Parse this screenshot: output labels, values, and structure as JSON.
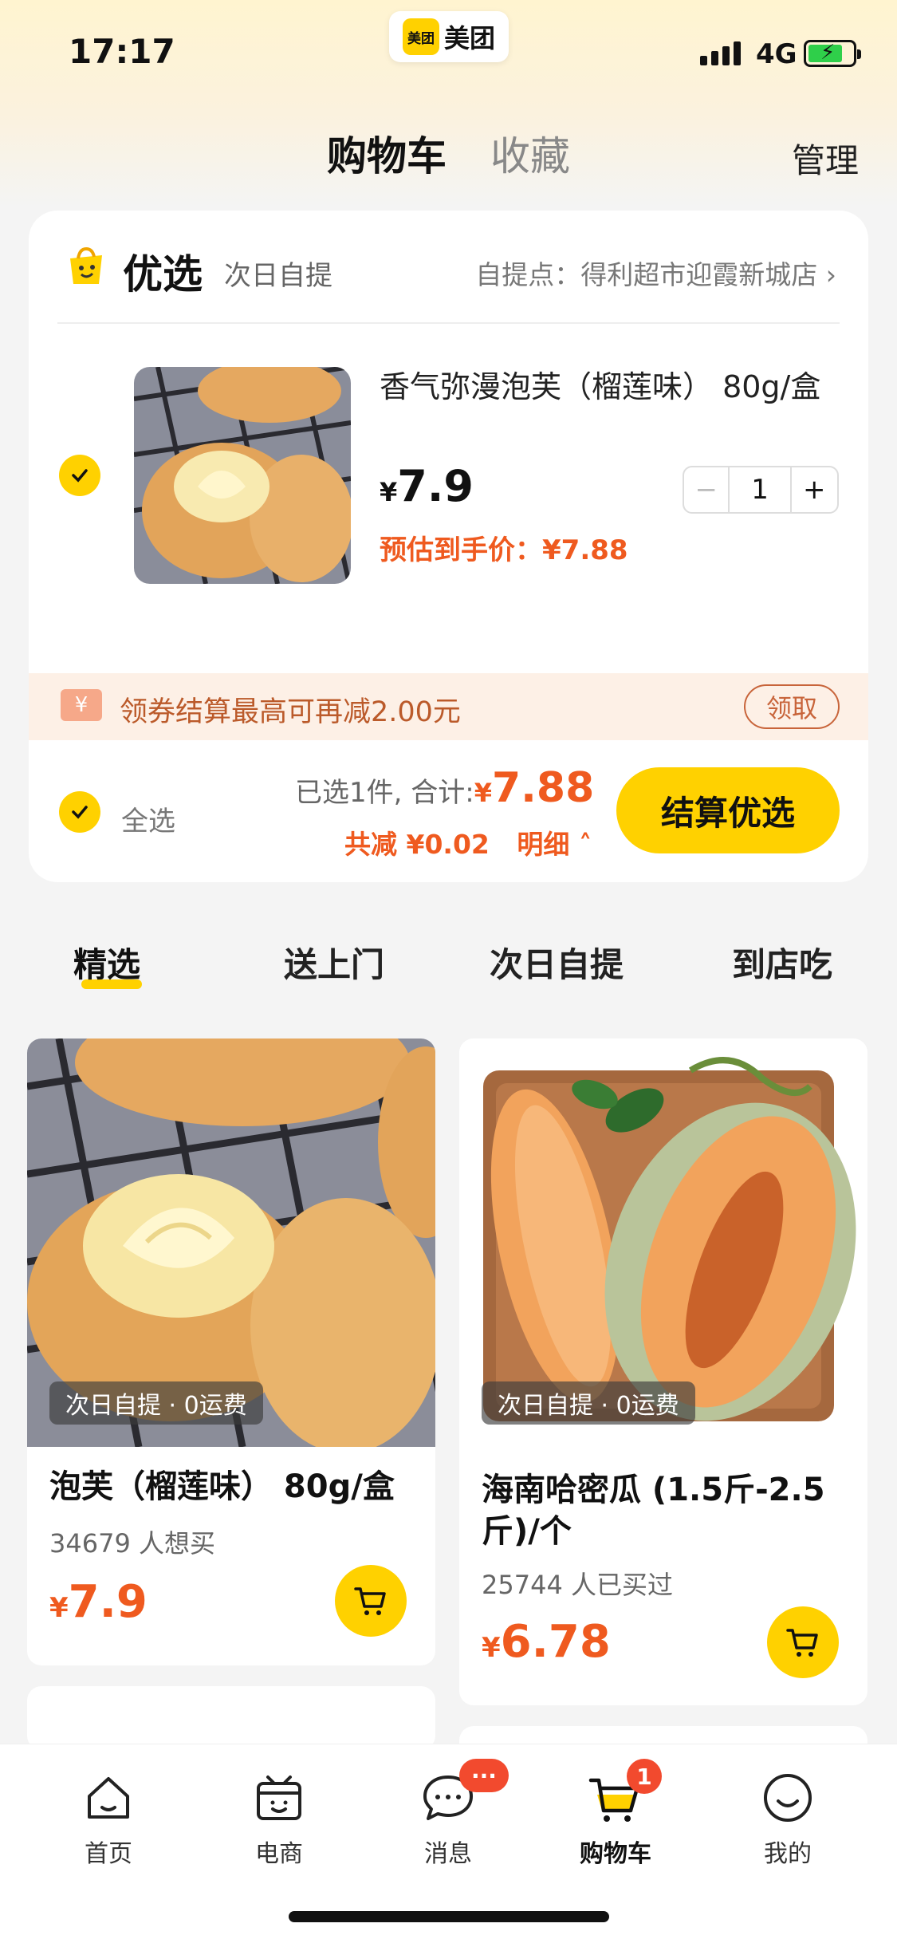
{
  "status_bar": {
    "time": "17:17",
    "network": "4G",
    "brand_logo": "美团",
    "brand_name": "美团"
  },
  "header": {
    "tab_cart": "购物车",
    "tab_favorites": "收藏",
    "manage": "管理"
  },
  "cart": {
    "store_name": "优选",
    "store_sub": "次日自提",
    "pickup_point": "自提点：得利超市迎霞新城店",
    "item": {
      "title": "香气弥漫泡芙（榴莲味） 80g/盒",
      "price_symbol": "¥",
      "price": "7.9",
      "estimate": "预估到手价：¥7.88",
      "quantity": "1",
      "minus": "−",
      "plus": "+",
      "selected": true
    },
    "coupon": {
      "icon_text": "¥",
      "text": "领券结算最高可再减2.00元",
      "button": "领取"
    },
    "footer": {
      "select_all": "全选",
      "summary_prefix": "已选1件, 合计:",
      "total_symbol": "¥",
      "total": "7.88",
      "discount": "共减 ¥0.02",
      "detail": "明细",
      "checkout": "结算优选"
    }
  },
  "categories": [
    "精选",
    "送上门",
    "次日自提",
    "到店吃"
  ],
  "products": [
    {
      "tag": "次日自提 · 0运费",
      "title": "泡芙（榴莲味） 80g/盒",
      "sold": "34679 人想买",
      "price_symbol": "¥",
      "price": "7.9"
    },
    {
      "tag": "次日自提 · 0运费",
      "title": "海南哈密瓜 (1.5斤-2.5斤)/个",
      "sold": "25744 人已买过",
      "price_symbol": "¥",
      "price": "6.78"
    }
  ],
  "bottom_nav": [
    {
      "label": "首页",
      "icon": "home-icon"
    },
    {
      "label": "电商",
      "icon": "shop-icon"
    },
    {
      "label": "消息",
      "icon": "message-icon",
      "badge": "···"
    },
    {
      "label": "购物车",
      "icon": "cart-icon",
      "badge": "1",
      "active": true
    },
    {
      "label": "我的",
      "icon": "profile-icon"
    }
  ],
  "colors": {
    "accent": "#ffd100",
    "price": "#ef5a1f",
    "badge": "#f24a2e"
  }
}
